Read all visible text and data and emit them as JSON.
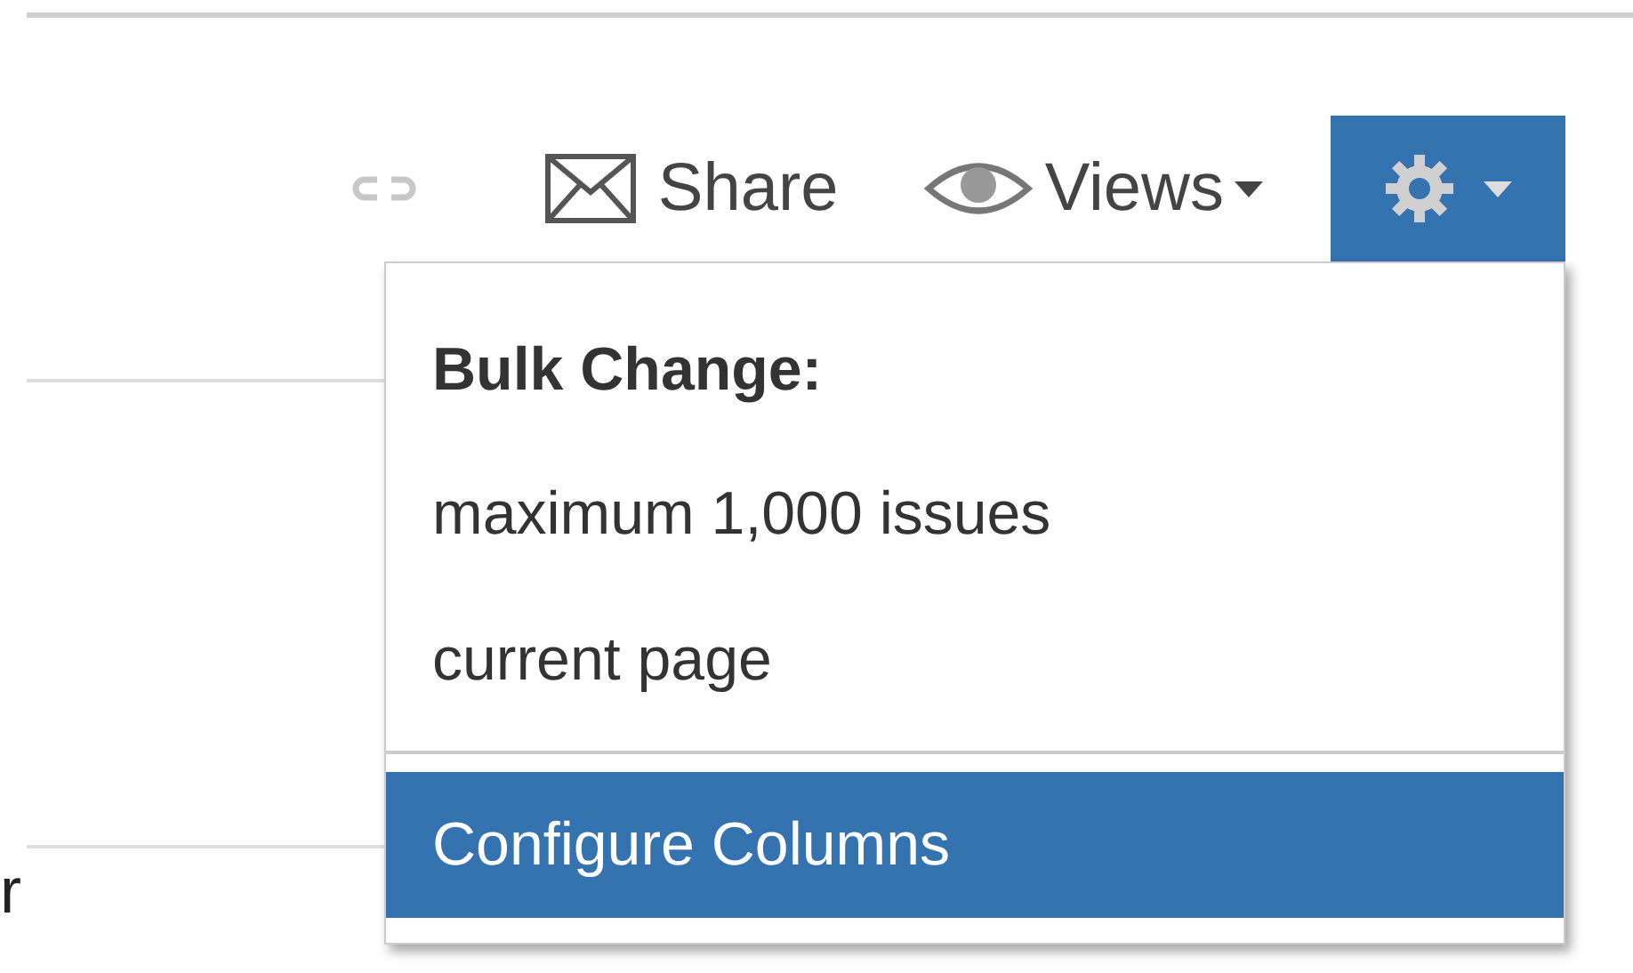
{
  "toolbar": {
    "share": {
      "label": "Share"
    },
    "views": {
      "label": "Views"
    },
    "settings": {
      "expanded": true
    }
  },
  "settings_menu": {
    "sections": [
      {
        "heading": "Bulk Change:",
        "items": [
          {
            "label": "maximum 1,000 issues",
            "selected": false
          },
          {
            "label": "current page",
            "selected": false
          }
        ]
      },
      {
        "items": [
          {
            "label": "Configure Columns",
            "selected": true
          }
        ]
      }
    ]
  },
  "page_text": "r"
}
